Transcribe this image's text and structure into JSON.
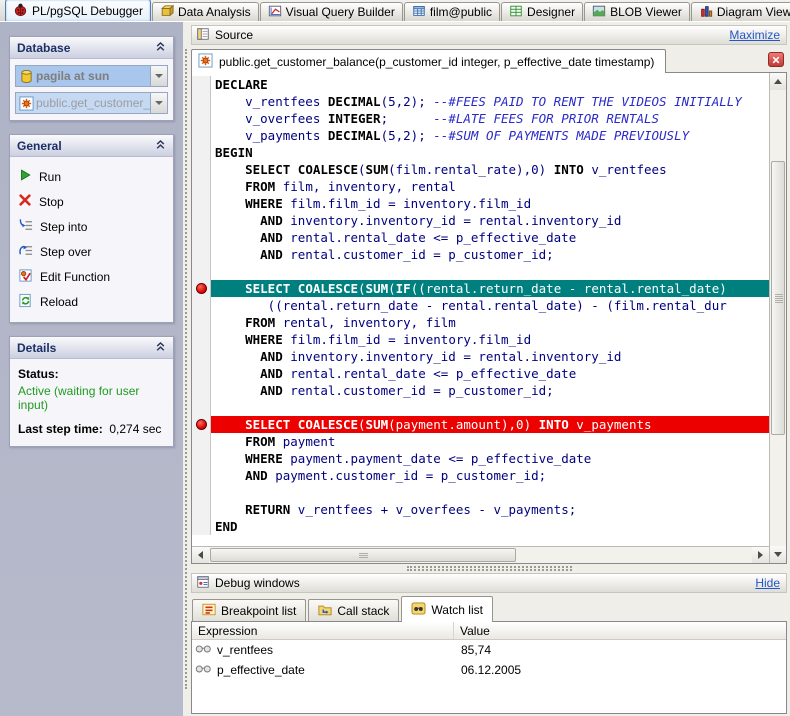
{
  "window": {
    "tabs": [
      {
        "label": "PL/pgSQL Debugger",
        "icon": "debugger-icon",
        "active": true
      },
      {
        "label": "Data Analysis",
        "icon": "data-analysis-icon",
        "active": false
      },
      {
        "label": "Visual Query Builder",
        "icon": "query-builder-icon",
        "active": false
      },
      {
        "label": "film@public",
        "icon": "table-icon",
        "active": false
      },
      {
        "label": "Designer",
        "icon": "designer-icon",
        "active": false
      },
      {
        "label": "BLOB Viewer",
        "icon": "blob-viewer-icon",
        "active": false
      },
      {
        "label": "Diagram Viewer",
        "icon": "diagram-viewer-icon",
        "active": false
      }
    ]
  },
  "sidebar": {
    "database": {
      "title": "Database",
      "combos": [
        {
          "value": "pagila at sun",
          "icon": "database-icon"
        },
        {
          "value": "public.get_customer_l",
          "icon": "function-icon"
        }
      ]
    },
    "general": {
      "title": "General",
      "actions": [
        {
          "label": "Run",
          "icon": "run-icon"
        },
        {
          "label": "Stop",
          "icon": "stop-icon"
        },
        {
          "label": "Step into",
          "icon": "step-into-icon"
        },
        {
          "label": "Step over",
          "icon": "step-over-icon"
        },
        {
          "label": "Edit Function",
          "icon": "edit-function-icon"
        },
        {
          "label": "Reload",
          "icon": "reload-icon"
        }
      ]
    },
    "details": {
      "title": "Details",
      "status_label": "Status:",
      "status_value": "Active (waiting for user input)",
      "last_step_label": "Last step time:",
      "last_step_value": "0,274 sec"
    }
  },
  "source": {
    "panel_title": "Source",
    "maximize_label": "Maximize",
    "function_tab": "public.get_customer_balance(p_customer_id integer, p_effective_date timestamp)",
    "code_lines": [
      {
        "segs": [
          [
            "kw",
            "DECLARE"
          ]
        ]
      },
      {
        "segs": [
          [
            "id",
            "    v_rentfees "
          ],
          [
            "kw",
            "DECIMAL"
          ],
          [
            "id",
            "(5,2); "
          ],
          [
            "cm",
            "--#FEES PAID TO RENT THE VIDEOS INITIALLY"
          ]
        ]
      },
      {
        "segs": [
          [
            "id",
            "    v_overfees "
          ],
          [
            "kw",
            "INTEGER"
          ],
          [
            "id",
            ";      "
          ],
          [
            "cm",
            "--#LATE FEES FOR PRIOR RENTALS"
          ]
        ]
      },
      {
        "segs": [
          [
            "id",
            "    v_payments "
          ],
          [
            "kw",
            "DECIMAL"
          ],
          [
            "id",
            "(5,2); "
          ],
          [
            "cm",
            "--#SUM OF PAYMENTS MADE PREVIOUSLY"
          ]
        ]
      },
      {
        "segs": [
          [
            "kw",
            "BEGIN"
          ]
        ]
      },
      {
        "segs": [
          [
            "id",
            "    "
          ],
          [
            "kw",
            "SELECT"
          ],
          [
            "id",
            " "
          ],
          [
            "kw",
            "COALESCE"
          ],
          [
            "id",
            "("
          ],
          [
            "kw",
            "SUM"
          ],
          [
            "id",
            "(film.rental_rate),0) "
          ],
          [
            "kw",
            "INTO"
          ],
          [
            "id",
            " v_rentfees"
          ]
        ]
      },
      {
        "segs": [
          [
            "id",
            "    "
          ],
          [
            "kw",
            "FROM"
          ],
          [
            "id",
            " film, inventory, rental"
          ]
        ]
      },
      {
        "segs": [
          [
            "id",
            "    "
          ],
          [
            "kw",
            "WHERE"
          ],
          [
            "id",
            " film.film_id = inventory.film_id"
          ]
        ]
      },
      {
        "segs": [
          [
            "id",
            "      "
          ],
          [
            "kw",
            "AND"
          ],
          [
            "id",
            " inventory.inventory_id = rental.inventory_id"
          ]
        ]
      },
      {
        "segs": [
          [
            "id",
            "      "
          ],
          [
            "kw",
            "AND"
          ],
          [
            "id",
            " rental.rental_date <= p_effective_date"
          ]
        ]
      },
      {
        "segs": [
          [
            "id",
            "      "
          ],
          [
            "kw",
            "AND"
          ],
          [
            "id",
            " rental.customer_id = p_customer_id;"
          ]
        ]
      },
      {
        "segs": []
      },
      {
        "hl": "teal",
        "bp": true,
        "segs": [
          [
            "id",
            "    "
          ],
          [
            "kw",
            "SELECT"
          ],
          [
            "id",
            " "
          ],
          [
            "kw",
            "COALESCE"
          ],
          [
            "id",
            "("
          ],
          [
            "kw",
            "SUM"
          ],
          [
            "id",
            "("
          ],
          [
            "kw",
            "IF"
          ],
          [
            "id",
            "((rental.return_date - rental.rental_date) "
          ]
        ]
      },
      {
        "segs": [
          [
            "id",
            "       ((rental.return_date - rental.rental_date) - (film.rental_dur"
          ]
        ]
      },
      {
        "segs": [
          [
            "id",
            "    "
          ],
          [
            "kw",
            "FROM"
          ],
          [
            "id",
            " rental, inventory, film"
          ]
        ]
      },
      {
        "segs": [
          [
            "id",
            "    "
          ],
          [
            "kw",
            "WHERE"
          ],
          [
            "id",
            " film.film_id = inventory.film_id"
          ]
        ]
      },
      {
        "segs": [
          [
            "id",
            "      "
          ],
          [
            "kw",
            "AND"
          ],
          [
            "id",
            " inventory.inventory_id = rental.inventory_id"
          ]
        ]
      },
      {
        "segs": [
          [
            "id",
            "      "
          ],
          [
            "kw",
            "AND"
          ],
          [
            "id",
            " rental.rental_date <= p_effective_date"
          ]
        ]
      },
      {
        "segs": [
          [
            "id",
            "      "
          ],
          [
            "kw",
            "AND"
          ],
          [
            "id",
            " rental.customer_id = p_customer_id;"
          ]
        ]
      },
      {
        "segs": []
      },
      {
        "hl": "red",
        "bp": true,
        "segs": [
          [
            "id",
            "    "
          ],
          [
            "kw",
            "SELECT"
          ],
          [
            "id",
            " "
          ],
          [
            "kw",
            "COALESCE"
          ],
          [
            "id",
            "("
          ],
          [
            "kw",
            "SUM"
          ],
          [
            "id",
            "(payment.amount),0) "
          ],
          [
            "kw",
            "INTO"
          ],
          [
            "id",
            " v_payments"
          ]
        ]
      },
      {
        "segs": [
          [
            "id",
            "    "
          ],
          [
            "kw",
            "FROM"
          ],
          [
            "id",
            " payment"
          ]
        ]
      },
      {
        "segs": [
          [
            "id",
            "    "
          ],
          [
            "kw",
            "WHERE"
          ],
          [
            "id",
            " payment.payment_date <= p_effective_date"
          ]
        ]
      },
      {
        "segs": [
          [
            "id",
            "    "
          ],
          [
            "kw",
            "AND"
          ],
          [
            "id",
            " payment.customer_id = p_customer_id;"
          ]
        ]
      },
      {
        "segs": []
      },
      {
        "segs": [
          [
            "id",
            "    "
          ],
          [
            "kw",
            "RETURN"
          ],
          [
            "id",
            " v_rentfees + v_overfees - v_payments;"
          ]
        ]
      },
      {
        "segs": [
          [
            "kw",
            "END"
          ]
        ]
      }
    ]
  },
  "debug": {
    "panel_title": "Debug windows",
    "hide_label": "Hide",
    "tabs": [
      {
        "label": "Breakpoint list",
        "icon": "breakpoint-list-icon",
        "active": false
      },
      {
        "label": "Call stack",
        "icon": "call-stack-icon",
        "active": false
      },
      {
        "label": "Watch list",
        "icon": "watch-list-icon",
        "active": true
      }
    ],
    "watch": {
      "columns": [
        "Expression",
        "Value"
      ],
      "rows": [
        {
          "expression": "v_rentfees",
          "value": "85,74"
        },
        {
          "expression": "p_effective_date",
          "value": "06.12.2005"
        }
      ]
    }
  },
  "colors": {
    "current_line_highlight": "#007F7F",
    "error_line_highlight": "#EC0000",
    "breakpoint_red": "#D60000",
    "status_green": "#1F9B1F",
    "link_blue": "#2456C8",
    "sidebar_bg": "#B2B6C8"
  }
}
